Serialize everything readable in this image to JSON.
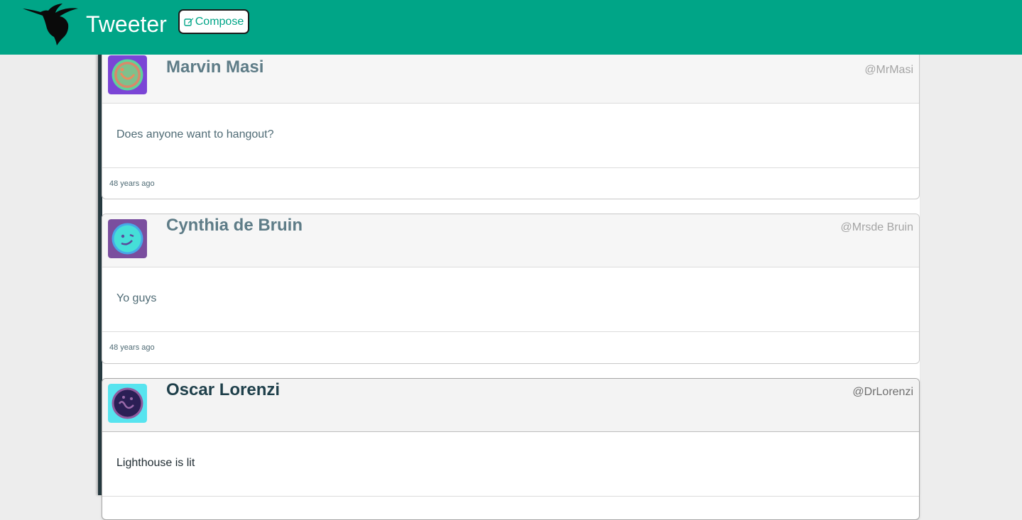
{
  "header": {
    "brand": "Tweeter",
    "compose_label": "Compose",
    "logo_icon": "hummingbird-icon",
    "background": "#00a587"
  },
  "tweets": [
    {
      "name": "Marvin Masi",
      "handle": "@MrMasi",
      "text": "Does anyone want to hangout?",
      "time": "48 years ago",
      "avatar": {
        "bg": "#7b45d6",
        "face": "#7fc08c",
        "ring": "#5dd39a",
        "feature": "#e98c5f"
      }
    },
    {
      "name": "Cynthia de Bruin",
      "handle": "@Mrsde Bruin",
      "text": "Yo guys",
      "time": "48 years ago",
      "avatar": {
        "bg": "#7a4e9e",
        "face": "#45dfd8",
        "ring": "#46a8e8",
        "feature": "#5a4a9a"
      }
    },
    {
      "name": "Oscar Lorenzi",
      "handle": "@DrLorenzi",
      "text": "Lighthouse is lit",
      "time": "",
      "avatar": {
        "bg": "#57e4ef",
        "face": "#2b1f55",
        "ring": "#8f5a9e",
        "feature": "#9a6aaa"
      }
    }
  ]
}
